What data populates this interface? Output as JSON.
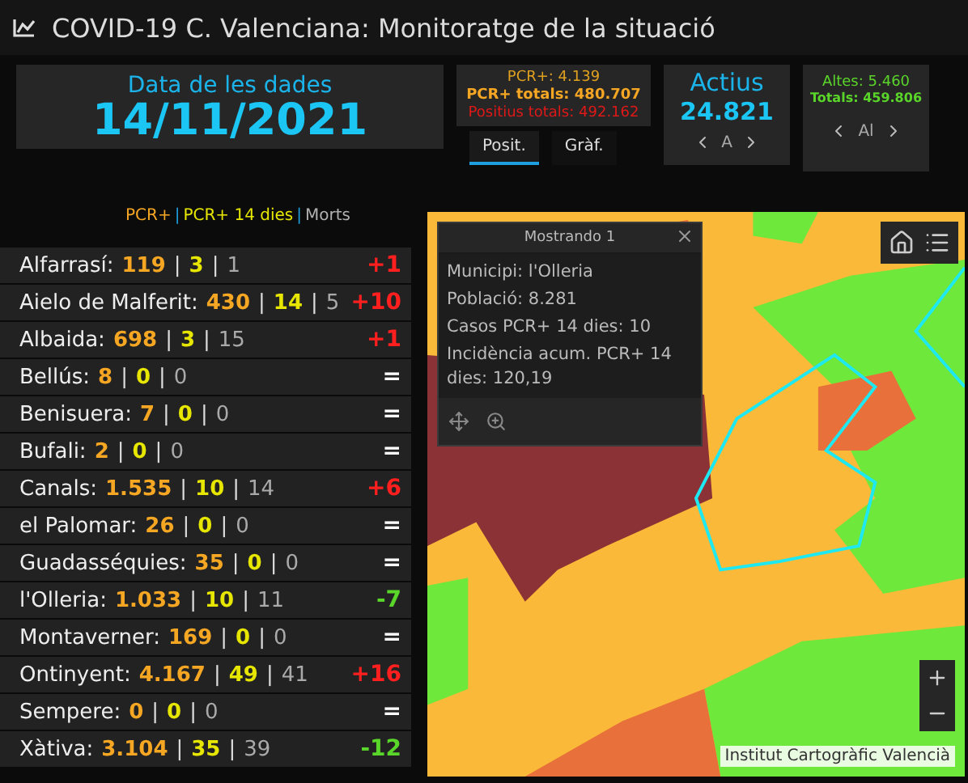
{
  "window": {
    "title": "COVID-19 C. Valenciana: Monitoratge de la situació"
  },
  "date_panel": {
    "label": "Data de les dades",
    "date": "14/11/2021"
  },
  "positives_panel": {
    "pcr": "PCR+: 4.139",
    "pcr_total": "PCR+ totals: 480.707",
    "positive_total": "Positius totals: 492.162"
  },
  "tabs": [
    {
      "label": "Posit.",
      "selected": true
    },
    {
      "label": "Gràf.",
      "selected": false
    }
  ],
  "active_panel": {
    "label": "Actius",
    "value": "24.821",
    "pager_label": "A"
  },
  "discharges_panel": {
    "discharges": "Altes: 5.460",
    "total": "Totals: 459.806",
    "pager_label": "Al"
  },
  "legend": {
    "separator": "|",
    "items": [
      {
        "label": "PCR+",
        "color": "#f5a623"
      },
      {
        "label": "PCR+ 14 dies",
        "color": "#e6e600"
      },
      {
        "label": "Morts",
        "color": "#b0b0b0"
      }
    ]
  },
  "municipalities": {
    "separator": "|",
    "rows": [
      {
        "name": "Alfarrasí:",
        "pcr": "119",
        "pcr14": "3",
        "deaths": "1",
        "change": "+1",
        "kind": "increase"
      },
      {
        "name": "Aielo de Malferit:",
        "pcr": "430",
        "pcr14": "14",
        "deaths": "5",
        "change": "+10",
        "kind": "increase"
      },
      {
        "name": "Albaida:",
        "pcr": "698",
        "pcr14": "3",
        "deaths": "15",
        "change": "+1",
        "kind": "increase"
      },
      {
        "name": "Bellús:",
        "pcr": "8",
        "pcr14": "0",
        "deaths": "0",
        "change": "=",
        "kind": "unchanged"
      },
      {
        "name": "Benisuera:",
        "pcr": "7",
        "pcr14": "0",
        "deaths": "0",
        "change": "=",
        "kind": "unchanged"
      },
      {
        "name": "Bufali:",
        "pcr": "2",
        "pcr14": "0",
        "deaths": "0",
        "change": "=",
        "kind": "unchanged"
      },
      {
        "name": "Canals:",
        "pcr": "1.535",
        "pcr14": "10",
        "deaths": "14",
        "change": "+6",
        "kind": "increase"
      },
      {
        "name": "el Palomar:",
        "pcr": "26",
        "pcr14": "0",
        "deaths": "0",
        "change": "=",
        "kind": "unchanged"
      },
      {
        "name": "Guadasséquies:",
        "pcr": "35",
        "pcr14": "0",
        "deaths": "0",
        "change": "=",
        "kind": "unchanged"
      },
      {
        "name": "l'Olleria:",
        "pcr": "1.033",
        "pcr14": "10",
        "deaths": "11",
        "change": "-7",
        "kind": "decrease"
      },
      {
        "name": "Montaverner:",
        "pcr": "169",
        "pcr14": "0",
        "deaths": "0",
        "change": "=",
        "kind": "unchanged"
      },
      {
        "name": "Ontinyent:",
        "pcr": "4.167",
        "pcr14": "49",
        "deaths": "41",
        "change": "+16",
        "kind": "increase"
      },
      {
        "name": "Sempere:",
        "pcr": "0",
        "pcr14": "0",
        "deaths": "0",
        "change": "=",
        "kind": "unchanged"
      },
      {
        "name": "Xàtiva:",
        "pcr": "3.104",
        "pcr14": "35",
        "deaths": "39",
        "change": "-12",
        "kind": "decrease"
      }
    ]
  },
  "map": {
    "kind": "picture",
    "attribution": "Institut Cartogràfic Valencià",
    "popup": {
      "title": "Mostrando 1",
      "lines": [
        "Municipi: l'Olleria",
        "Població: 8.281",
        "Casos PCR+ 14 dies: 10",
        "Incidència acum. PCR+ 14 dies: 120,19"
      ]
    }
  }
}
